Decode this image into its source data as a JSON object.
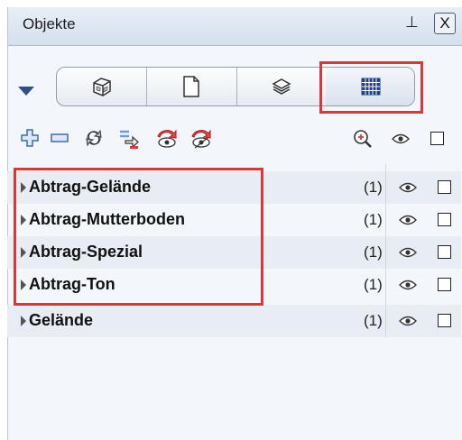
{
  "panel": {
    "title": "Objekte",
    "pin_glyph": "⊥",
    "close_glyph": "X"
  },
  "view_tabs": [
    {
      "icon": "cube-icon",
      "active": false
    },
    {
      "icon": "page-icon",
      "active": false
    },
    {
      "icon": "layers-icon",
      "active": false
    },
    {
      "icon": "grid-icon",
      "active": true
    }
  ],
  "toolbar": [
    {
      "icon": "add-icon"
    },
    {
      "icon": "remove-icon"
    },
    {
      "icon": "refresh-icon"
    },
    {
      "icon": "move-icon"
    },
    {
      "icon": "hide-icon"
    },
    {
      "icon": "unhide-icon"
    },
    {
      "icon": "zoom-in-icon"
    },
    {
      "icon": "eye-icon"
    },
    {
      "icon": "checkbox-icon"
    }
  ],
  "rows": [
    {
      "label": "Abtrag-Gelände",
      "count": "(1)"
    },
    {
      "label": "Abtrag-Mutterboden",
      "count": "(1)"
    },
    {
      "label": "Abtrag-Spezial",
      "count": "(1)"
    },
    {
      "label": "Abtrag-Ton",
      "count": "(1)"
    },
    {
      "label": "Gelände",
      "count": "(1)"
    }
  ],
  "colors": {
    "highlight": "#d9383a",
    "accent": "#2c5289",
    "title_bg": "#dce5f1"
  }
}
